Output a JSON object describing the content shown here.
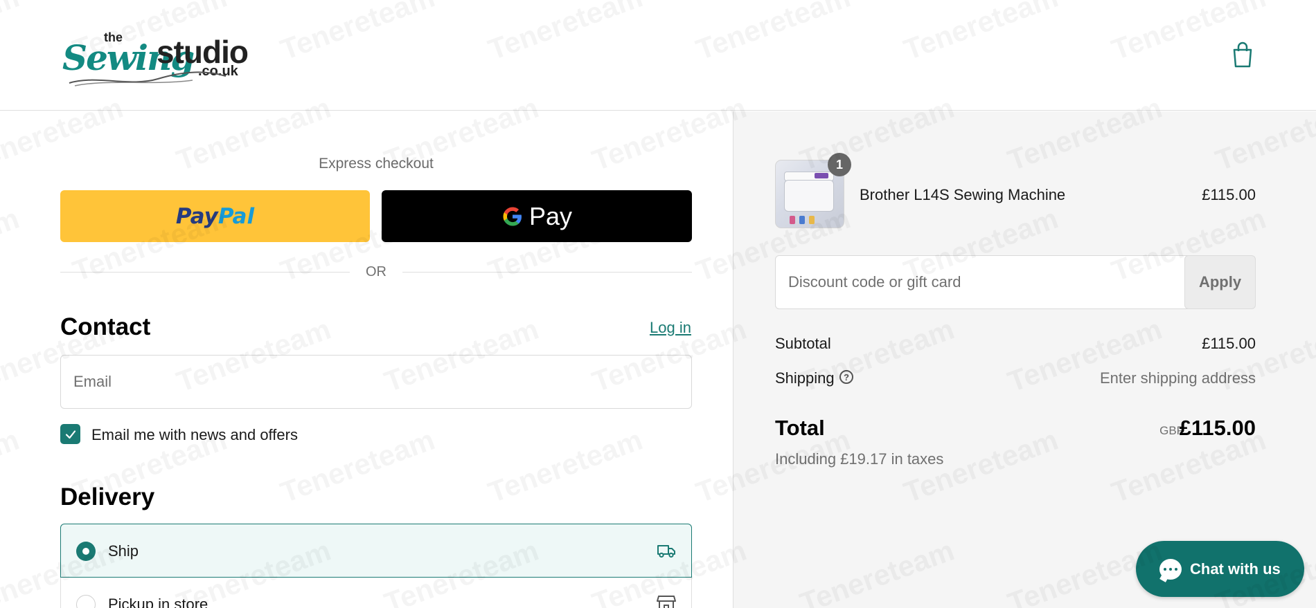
{
  "brand": {
    "logo_the": "the",
    "logo_sewing": "Sewing",
    "logo_studio": "studio",
    "logo_tld": ".co.uk",
    "accent_color": "#1a7a73"
  },
  "header": {
    "cart_icon": "shopping-bag-icon"
  },
  "express": {
    "label": "Express checkout",
    "paypal_part1": "Pay",
    "paypal_part2": "Pal",
    "gpay_label": "Pay",
    "or_label": "OR"
  },
  "contact": {
    "title": "Contact",
    "login_label": "Log in",
    "email_placeholder": "Email",
    "news_label": "Email me with news and offers",
    "news_checked": true
  },
  "delivery": {
    "title": "Delivery",
    "options": [
      {
        "label": "Ship",
        "selected": true,
        "icon": "truck-icon"
      },
      {
        "label": "Pickup in store",
        "selected": false,
        "icon": "store-icon"
      }
    ]
  },
  "summary": {
    "item": {
      "name": "Brother L14S Sewing Machine",
      "price": "£115.00",
      "quantity": "1"
    },
    "discount_placeholder": "Discount code or gift card",
    "apply_label": "Apply",
    "subtotal_label": "Subtotal",
    "subtotal_value": "£115.00",
    "shipping_label": "Shipping",
    "shipping_help_glyph": "?",
    "shipping_value": "Enter shipping address",
    "total_label": "Total",
    "currency": "GBP",
    "total_value": "£115.00",
    "taxes_note": "Including £19.17 in taxes"
  },
  "chat": {
    "label": "Chat with us"
  },
  "watermark_text": "Tenereteam"
}
